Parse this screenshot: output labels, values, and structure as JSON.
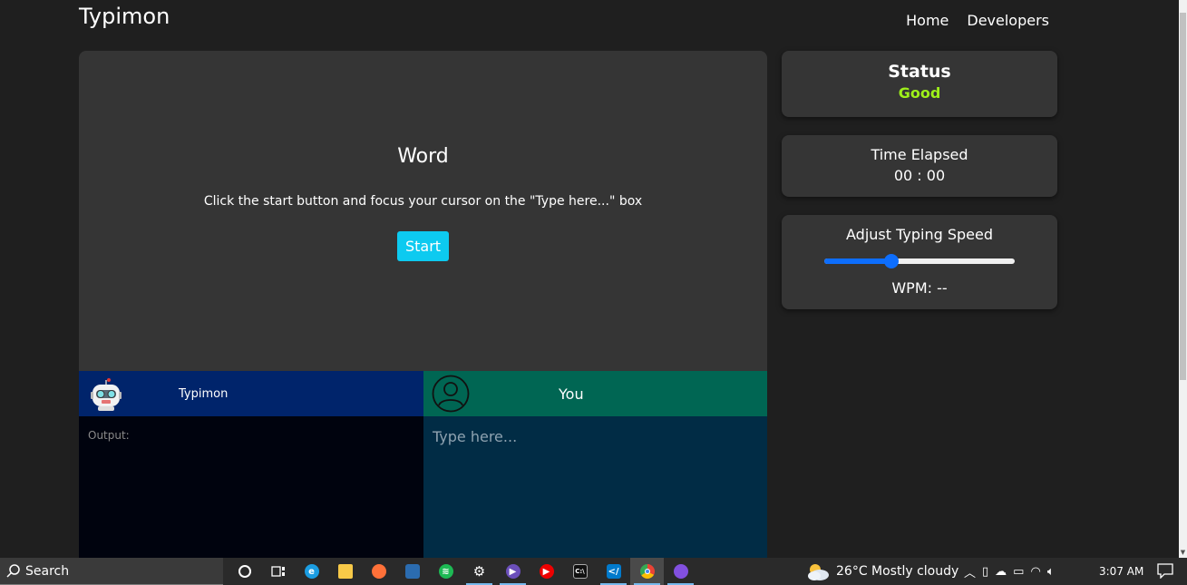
{
  "navbar": {
    "brand": "Typimon",
    "links": [
      "Home",
      "Developers"
    ]
  },
  "main": {
    "word": "Word",
    "instruction": "Click the start button and focus your cursor on the \"Type here...\" box",
    "start_label": "Start"
  },
  "bot_panel": {
    "name": "Typimon",
    "output_label": "Output:"
  },
  "user_panel": {
    "name": "You",
    "placeholder": "Type here..."
  },
  "status": {
    "title": "Status",
    "value": "Good",
    "value_color": "#9ef01a"
  },
  "timer": {
    "title": "Time Elapsed",
    "value": "00 : 00"
  },
  "speed": {
    "title": "Adjust Typing Speed",
    "slider_fraction": 0.35,
    "wpm_label": "WPM: --"
  },
  "colors": {
    "accent": "#0dcaf0",
    "bot_header": "#00246b",
    "user_header": "#006653",
    "slider": "#0d6efd"
  },
  "taskbar": {
    "search_label": "Search",
    "apps": [
      "task-view-icon",
      "cortana-icon",
      "edge-icon",
      "file-explorer-icon",
      "firefox-icon",
      "remote-desktop-icon",
      "spotify-icon",
      "settings-icon",
      "media-player-icon",
      "youtube-music-icon",
      "terminal-icon",
      "vscode-icon",
      "chrome-icon",
      "github-desktop-icon"
    ],
    "weather": "26°C  Mostly cloudy",
    "time": "3:07 AM"
  }
}
